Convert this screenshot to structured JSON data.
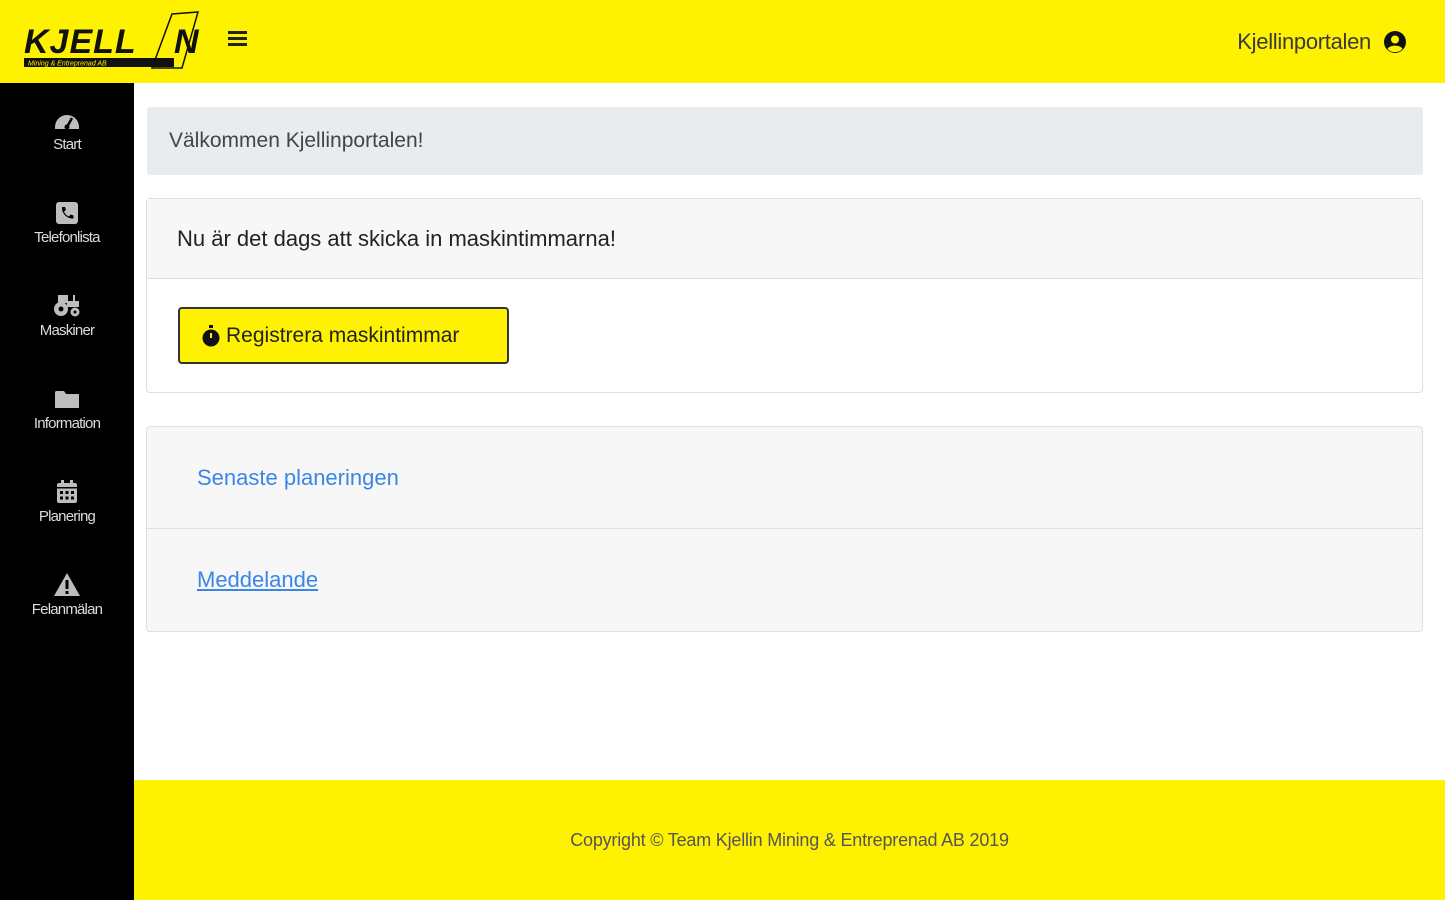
{
  "header": {
    "logo_text": "KJELLIN",
    "logo_subtext": "Mining & Entreprenad AB",
    "title": "Kjellinportalen",
    "accent_color": "#fff200"
  },
  "sidebar": {
    "items": [
      {
        "label": "Start",
        "icon": "dashboard-icon"
      },
      {
        "label": "Telefonlista",
        "icon": "phone-square-icon"
      },
      {
        "label": "Maskiner",
        "icon": "tractor-icon"
      },
      {
        "label": "Information",
        "icon": "folder-icon"
      },
      {
        "label": "Planering",
        "icon": "calendar-icon"
      },
      {
        "label": "Felanmälan",
        "icon": "warning-icon"
      }
    ]
  },
  "main": {
    "welcome": "Välkommen Kjellinportalen!",
    "card": {
      "header": "Nu är det dags att skicka in maskintimmarna!",
      "button_label": "Registrera maskintimmar"
    },
    "links": [
      {
        "label": "Senaste planeringen"
      },
      {
        "label": "Meddelande"
      }
    ]
  },
  "footer": {
    "copyright": "Copyright © Team Kjellin Mining & Entreprenad AB 2019"
  }
}
